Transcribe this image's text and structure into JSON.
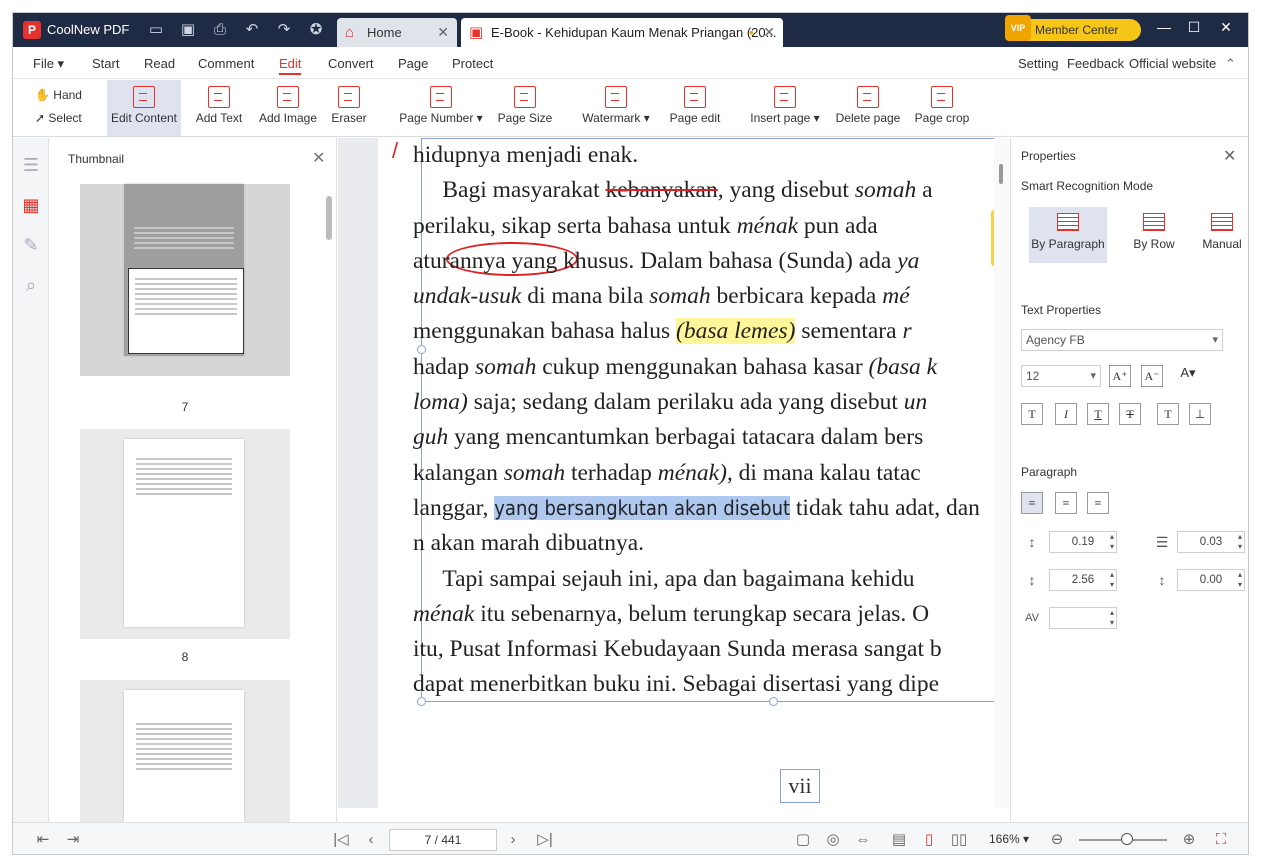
{
  "app": {
    "name": "CoolNew PDF",
    "logo": "P"
  },
  "tabs": [
    {
      "label": "Home",
      "icon": "home-icon"
    },
    {
      "label": "E-Book - Kehidupan Kaum Menak Priangan (20...",
      "icon": "pdf-icon",
      "modified": "•"
    }
  ],
  "member_center": "Member Center",
  "member_badge": "VIP",
  "menu": {
    "items": [
      "File ▾",
      "Start",
      "Read",
      "Comment",
      "Edit",
      "Convert",
      "Page",
      "Protect"
    ],
    "active": "Edit",
    "right": [
      "Setting",
      "Feedback",
      "Official website"
    ]
  },
  "toolbar": {
    "hand": "Hand",
    "select": "Select",
    "tools": [
      "Edit Content",
      "Add Text",
      "Add Image",
      "Eraser",
      "Page Number ▾",
      "Page Size",
      "Watermark ▾",
      "Page edit",
      "Insert page ▾",
      "Delete page",
      "Page crop"
    ]
  },
  "thumbnail": {
    "title": "Thumbnail",
    "pages": [
      "7",
      "8"
    ]
  },
  "document": {
    "lines": [
      "hidupnya menjadi enak.",
      "Bagi masyarakat ",
      "perilaku, sikap serta bahasa untuk ",
      "aturannya yang khusus. Dalam bahasa (Sunda) ada ",
      "undak-usuk",
      "menggunakan bahasa halus ",
      "hadap ",
      "loma)",
      "guh",
      "kalangan ",
      "langgar, ",
      "n akan marah dibuatnya.",
      "Tapi sampai sejauh ini, apa dan bagaimana kehidu",
      "ménak",
      "itu, Pusat Informasi Kebudayaan Sunda merasa sangat b",
      "dapat menerbitkan buku ini. Sebagai disertasi yang dipe"
    ],
    "fragments": {
      "kebanyakan": "kebanyakan",
      "l1b": ", yang disebut ",
      "somah": "somah",
      "l1c": " a",
      "menak": "ménak",
      "l2b": " pun ada",
      "ya": "ya",
      "l4b": " di mana bila ",
      "l4c": " berbicara kepada ",
      "me": "mé",
      "basa_lemes": "(basa lemes)",
      "l5b": " sementara ",
      "r": "r",
      "l6b": " cukup menggunakan bahasa kasar ",
      "basa_k": "(basa k",
      "l7b": " saja; sedang dalam perilaku ada yang disebut ",
      "un": "un",
      "l8b": " yang mencantumkan berbagai tatacara dalam bers",
      "l9b": " terhadap ",
      "menak2": "ménak),",
      "l9c": " di mana kalau tatac",
      "selected": "yang bersangkutan akan disebut",
      "l10b": " tidak tahu adat, dan",
      "l13b": " itu sebenarnya, belum terungkap secara jelas. O"
    },
    "page_label": "vii"
  },
  "properties": {
    "title": "Properties",
    "smart_mode": "Smart Recognition Mode",
    "modes": [
      "By Paragraph",
      "By Row",
      "Manual"
    ],
    "text_props": "Text Properties",
    "font": "Agency FB",
    "size": "12",
    "paragraph": "Paragraph",
    "line_spacing": "0.19",
    "indent": "0.03",
    "para_before": "2.56",
    "para_after": "0.00",
    "char_spacing": ""
  },
  "statusbar": {
    "page": "7 / 441",
    "zoom": "166% ▾"
  }
}
